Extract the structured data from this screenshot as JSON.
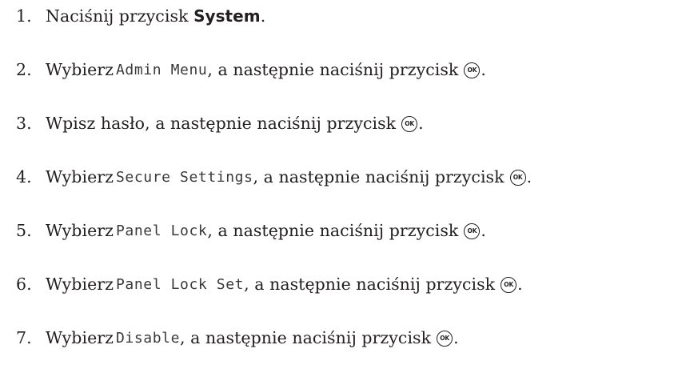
{
  "steps": [
    {
      "number": "1.",
      "text_before": "Naciśnij przycisk ",
      "button_name": "System",
      "text_after": "."
    },
    {
      "number": "2.",
      "prefix": "Wybierz",
      "menu_item": "Admin Menu",
      "suffix": ", a następnie naciśnij przycisk",
      "end": "."
    },
    {
      "number": "3.",
      "text": "Wpisz hasło, a następnie naciśnij przycisk",
      "end": "."
    },
    {
      "number": "4.",
      "prefix": "Wybierz",
      "menu_item": "Secure Settings",
      "suffix": ", a następnie naciśnij przycisk",
      "end": "."
    },
    {
      "number": "5.",
      "prefix": "Wybierz",
      "menu_item": "Panel Lock",
      "suffix": ", a następnie naciśnij przycisk",
      "end": "."
    },
    {
      "number": "6.",
      "prefix": "Wybierz",
      "menu_item": "Panel Lock Set",
      "suffix": ", a następnie naciśnij przycisk",
      "end": "."
    },
    {
      "number": "7.",
      "prefix": "Wybierz",
      "menu_item": "Disable",
      "suffix": ", a następnie naciśnij przycisk",
      "end": "."
    }
  ],
  "ok_button": {
    "label": "OK",
    "icon": "ok-button-icon"
  },
  "colors": {
    "text": "#231f20",
    "lcd_text": "#3a3a3a",
    "background": "#ffffff"
  }
}
